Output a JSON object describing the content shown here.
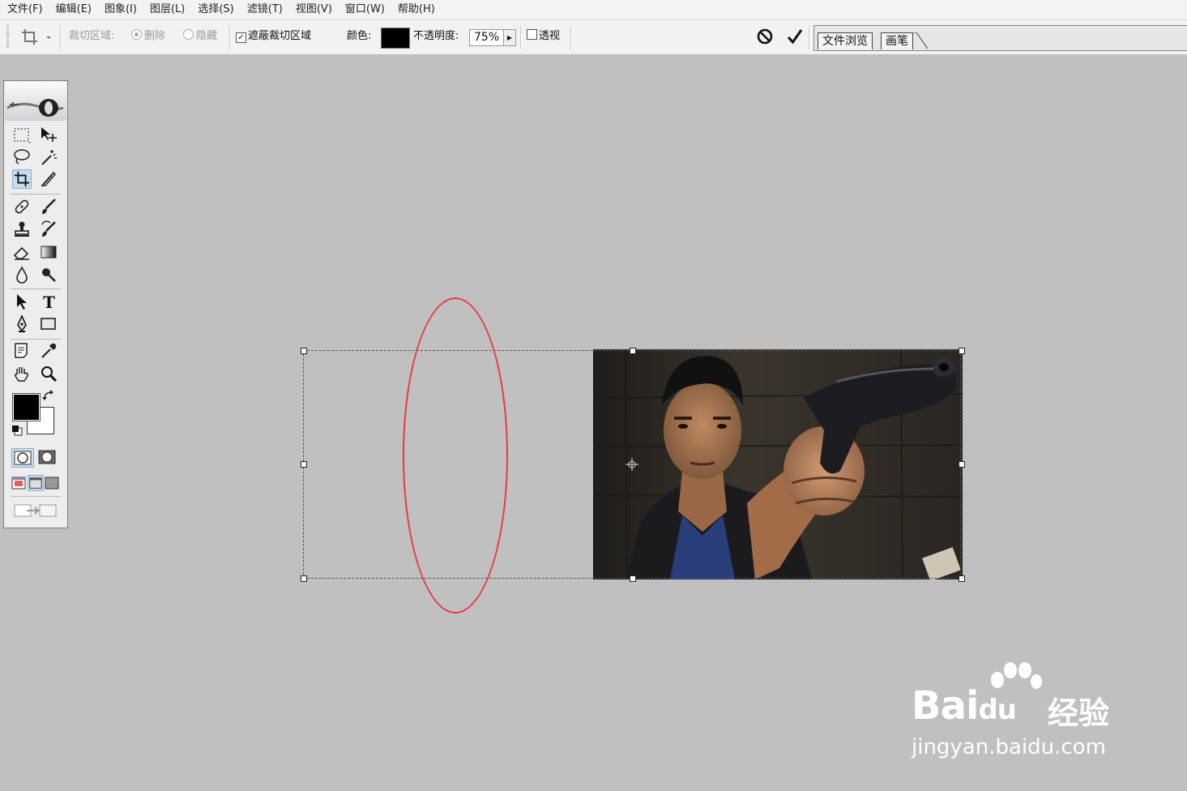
{
  "menu": [
    "文件(F)",
    "编辑(E)",
    "图象(I)",
    "图层(L)",
    "选择(S)",
    "滤镜(T)",
    "视图(V)",
    "窗口(W)",
    "帮助(H)"
  ],
  "options": {
    "crop_area_label": "裁切区域:",
    "delete_label": "删除",
    "hide_label": "隐藏",
    "shield_label": "遮蔽裁切区域",
    "shield_checked": true,
    "color_label": "颜色:",
    "shield_color": "#000000",
    "opacity_label": "不透明度:",
    "opacity_value": "75%",
    "perspective_label": "透视",
    "perspective_checked": false
  },
  "palette_well": {
    "tabs": [
      "文件浏览",
      "画笔"
    ]
  },
  "toolbox": {
    "foreground_color": "#000000",
    "background_color": "#ffffff"
  },
  "annotation": {
    "color": "#e8393a"
  },
  "watermark": {
    "brand": "Bai",
    "brand_suffix": "du",
    "cn": "经验",
    "url": "jingyan.baidu.com"
  }
}
